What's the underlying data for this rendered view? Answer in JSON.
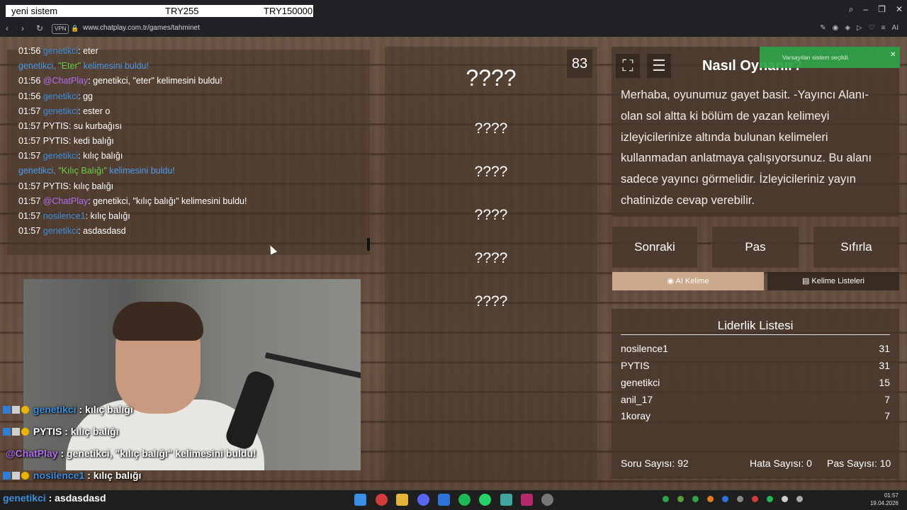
{
  "overlay": {
    "title": "yeni sistem",
    "amount_a": "TRY255",
    "amount_b": "TRY150000"
  },
  "browser": {
    "url": "www.chatplay.com.tr/games/tahminet",
    "vpn_label": "VPN",
    "ai_label": "AI"
  },
  "chat": {
    "lines": [
      {
        "time": "01:56",
        "user": "genetikci",
        "text": "eter"
      },
      {
        "sys_user": "genetikci, ",
        "word": "\"Eter\"",
        "sys_tail": " kelimesini buldu!"
      },
      {
        "time": "01:56",
        "chatplay": "@ChatPlay",
        "text": "genetikci, \"eter\" kelimesini buldu!"
      },
      {
        "time": "01:56",
        "user": "genetikci",
        "text": "gg"
      },
      {
        "time": "01:57",
        "user": "genetikci",
        "text": "ester o"
      },
      {
        "time": "01:57",
        "plain_user": "PYTIS",
        "text": "su kurbağısı"
      },
      {
        "time": "01:57",
        "plain_user": "PYTIS",
        "text": "kedi balığı"
      },
      {
        "time": "01:57",
        "user": "genetikci",
        "text": "kılıç balığı"
      },
      {
        "sys_user": "genetikci, ",
        "word": "\"Kılıç Balığı\"",
        "sys_tail": " kelimesini buldu!"
      },
      {
        "time": "01:57",
        "plain_user": "PYTIS",
        "text": "kılıç balığı"
      },
      {
        "time": "01:57",
        "chatplay": "@ChatPlay",
        "text": "genetikci, \"kılıç balığı\" kelimesini buldu!"
      },
      {
        "time": "01:57",
        "user": "nosilence1",
        "text": "kılıç balığı"
      },
      {
        "time": "01:57",
        "user": "genetikci",
        "text": "asdasdasd"
      }
    ]
  },
  "stream_chat": {
    "l1_user": "genetikci",
    "l1_text": " : kılıç balığı",
    "l2_user": "PYTIS",
    "l2_text": " : kılıç balığı",
    "l3_user": "@ChatPlay",
    "l3_text": " : genetikci, \"kılıç balığı\" kelimesini buldu!",
    "l4_user": "nosilence1",
    "l4_text": " : kılıç balığı",
    "l5_user": "genetikci",
    "l5_text": " : asdasdasd"
  },
  "game": {
    "timer": "83",
    "main_word": "????",
    "forbidden": [
      "????",
      "????",
      "????",
      "????",
      "????"
    ]
  },
  "info": {
    "title": "Nasıl Oynanır?",
    "text": "Merhaba, oyunumuz gayet basit. -Yayıncı Alanı- olan sol altta ki bölüm de yazan kelimeyi izleyicilerinize altında bulunan kelimeleri kullanmadan anlatmaya çalışıyorsunuz. Bu alanı sadece yayıncı görmelidir. İzleyicileriniz yayın chatinizde cevap verebilir."
  },
  "actions": {
    "next": "Sonraki",
    "pass": "Pas",
    "reset": "Sıfırla",
    "ai_word": "AI Kelime",
    "word_lists": "Kelime Listeleri"
  },
  "leaderboard": {
    "title": "Liderlik Listesi",
    "rows": [
      {
        "name": "nosilence1",
        "score": "31"
      },
      {
        "name": "PYTIS",
        "score": "31"
      },
      {
        "name": "genetikci",
        "score": "15"
      },
      {
        "name": "anil_17",
        "score": "7"
      },
      {
        "name": "1koray",
        "score": "7"
      }
    ],
    "questions": "Soru Sayısı: 92",
    "errors": "Hata Sayısı: 0",
    "passes": "Pas Sayısı: 10"
  },
  "toast": "Varsayılan sistem seçildi.",
  "clock": {
    "time": "01:57",
    "date": "19.04.2026"
  },
  "colors": {
    "user": "#3d8ee0",
    "chatplay": "#b06ef0",
    "found_word": "#6ad04a",
    "toast": "#2fa348"
  },
  "icons": [
    "back-icon",
    "forward-icon",
    "reload-icon",
    "lock-icon",
    "fullscreen-icon",
    "notes-icon",
    "gear-icon",
    "ai-icon",
    "list-icon"
  ]
}
